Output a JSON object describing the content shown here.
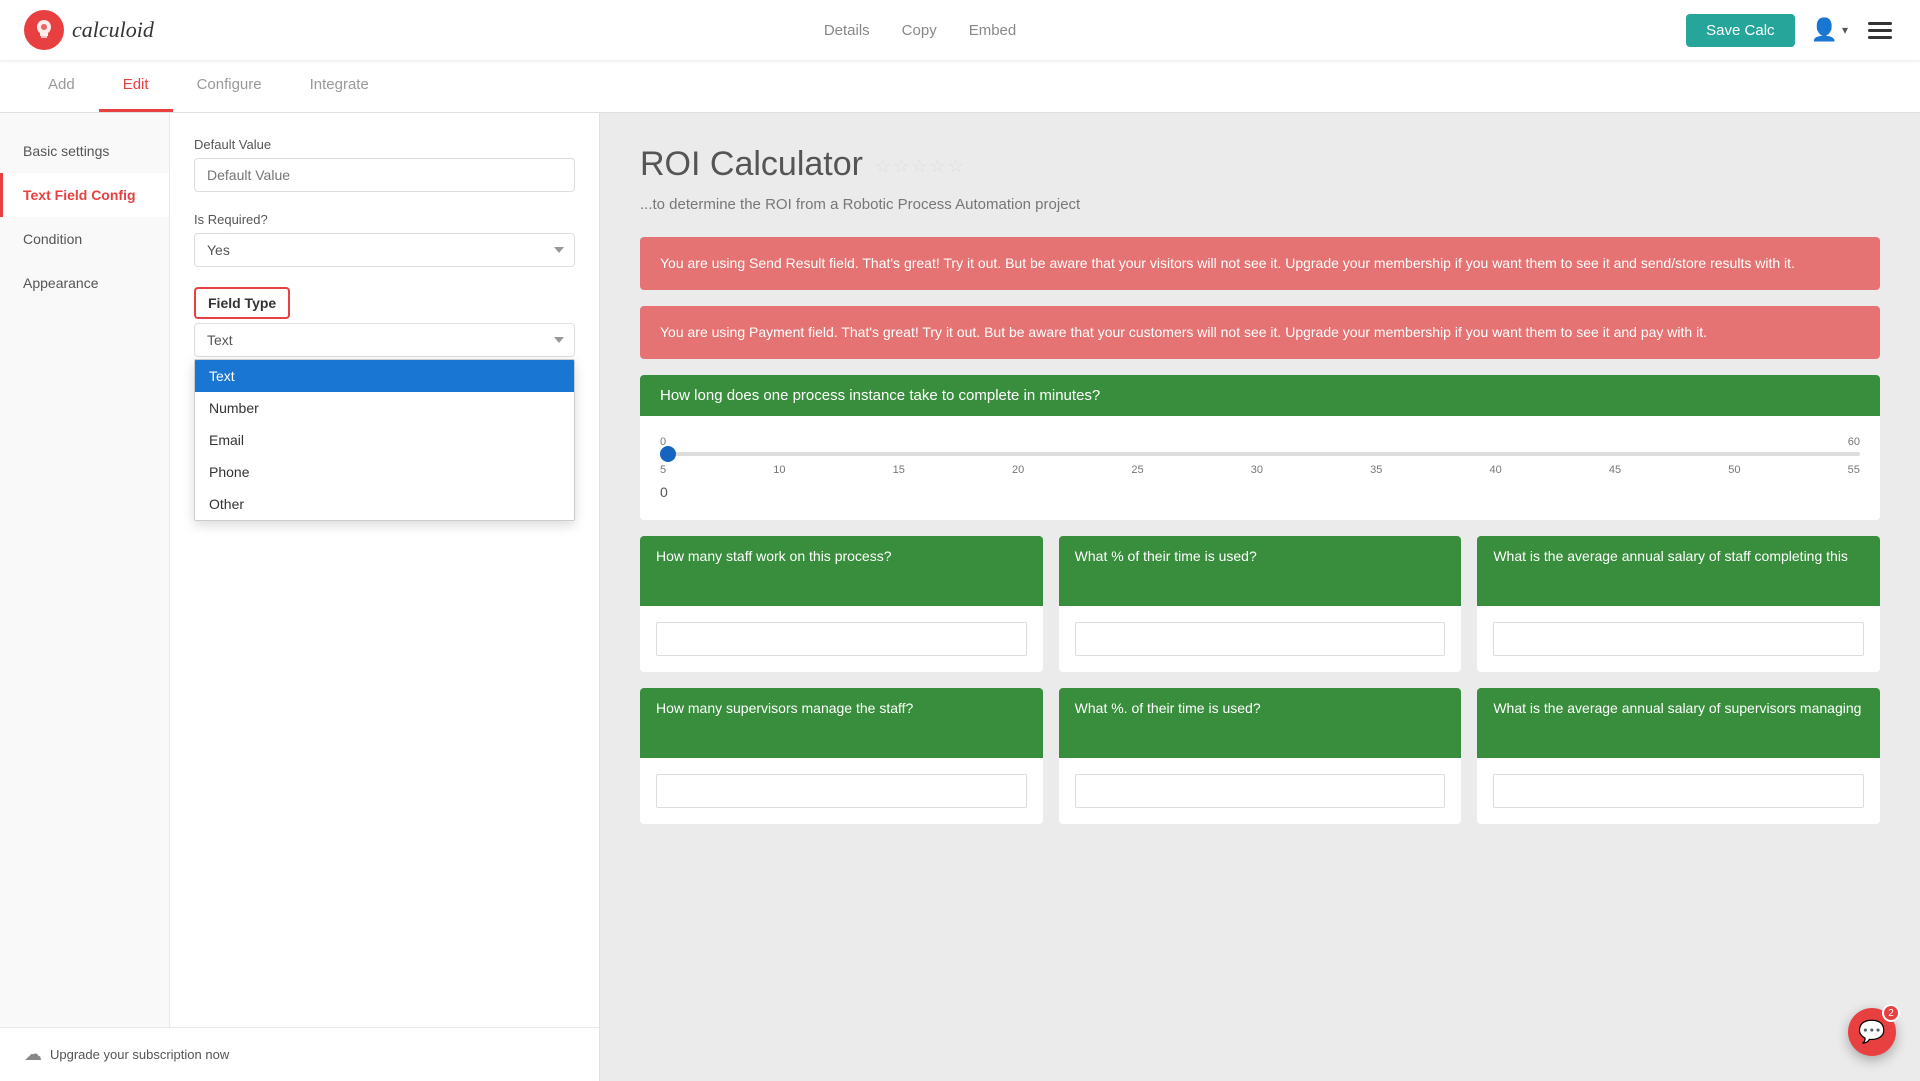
{
  "header": {
    "logo_letter": "c",
    "logo_text": "calculoid",
    "nav": {
      "details": "Details",
      "copy": "Copy",
      "embed": "Embed",
      "save": "Save Calc"
    }
  },
  "tabs": [
    {
      "id": "add",
      "label": "Add",
      "active": false
    },
    {
      "id": "edit",
      "label": "Edit",
      "active": true
    },
    {
      "id": "configure",
      "label": "Configure",
      "active": false
    },
    {
      "id": "integrate",
      "label": "Integrate",
      "active": false
    }
  ],
  "sidebar_nav": [
    {
      "id": "basic-settings",
      "label": "Basic settings",
      "active": false
    },
    {
      "id": "text-field-config",
      "label": "Text Field Config",
      "active": true
    },
    {
      "id": "condition",
      "label": "Condition",
      "active": false
    },
    {
      "id": "appearance",
      "label": "Appearance",
      "active": false
    }
  ],
  "form": {
    "default_value_label": "Default Value",
    "default_value_placeholder": "Default Value",
    "is_required_label": "Is Required?",
    "is_required_value": "Yes",
    "field_type_label": "Field Type",
    "field_type_value": "Text",
    "dropdown_options": [
      {
        "id": "text",
        "label": "Text",
        "selected": true
      },
      {
        "id": "number",
        "label": "Number",
        "selected": false
      },
      {
        "id": "email",
        "label": "Email",
        "selected": false
      },
      {
        "id": "phone",
        "label": "Phone",
        "selected": false
      },
      {
        "id": "other",
        "label": "Other",
        "selected": false
      }
    ]
  },
  "upgrade": {
    "text": "Upgrade your subscription now",
    "icon": "☁"
  },
  "preview": {
    "title": "ROI Calculator",
    "subtitle": "...to determine the ROI from a Robotic Process Automation project",
    "stars": [
      "★",
      "★",
      "★",
      "★",
      "★"
    ],
    "alert1": "You are using Send Result field. That's great! Try it out. But be aware that your visitors will not see it. Upgrade your membership if you want them to see it and send/store results with it.",
    "alert2": "You are using Payment field. That's great! Try it out. But be aware that your customers will not see it. Upgrade your membership if you want them to see it and pay with it.",
    "slider": {
      "question": "How long does one process instance take to complete in minutes?",
      "min": 0,
      "max": 60,
      "value": 0,
      "tick_labels": [
        "0",
        "5",
        "10",
        "15",
        "20",
        "25",
        "30",
        "35",
        "40",
        "45",
        "50",
        "55",
        "60"
      ]
    },
    "cards": [
      {
        "question": "How many staff work on this process?",
        "placeholder": ""
      },
      {
        "question": "What % of their time is used?",
        "placeholder": ""
      },
      {
        "question": "What is the average annual salary of staff completing this",
        "placeholder": ""
      },
      {
        "question": "How many supervisors manage the staff?",
        "placeholder": ""
      },
      {
        "question": "What %. of their time is used?",
        "placeholder": ""
      },
      {
        "question": "What is the average annual salary of supervisors managing",
        "placeholder": ""
      }
    ]
  },
  "chat": {
    "icon": "💬",
    "badge": "2"
  }
}
